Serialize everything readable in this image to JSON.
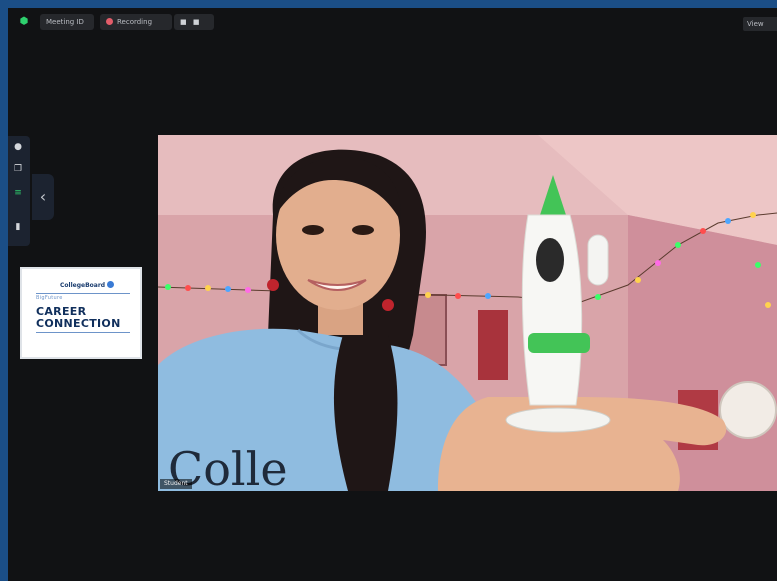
{
  "topbar": {
    "meeting_label": "Meeting ID",
    "recording_label": "Recording",
    "controls_label": "■ ■",
    "view_label": "View"
  },
  "share_thumbnail": {
    "brand": "CollegeBoard",
    "subtitle": "BigFuture",
    "title_line1": "CAREER",
    "title_line2": "CONNECTION"
  },
  "video": {
    "participant_name": "Student",
    "shirt_text": "Colle"
  },
  "colors": {
    "outer_frame": "#1b4e86",
    "app_background": "#111214",
    "accent_green": "#2ed06e"
  }
}
